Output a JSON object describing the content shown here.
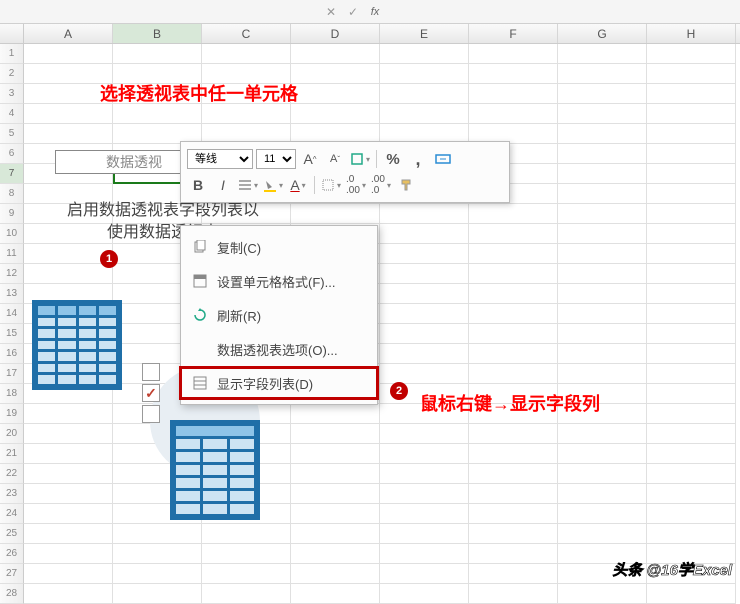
{
  "formula_bar": {
    "cancel": "✕",
    "confirm": "✓",
    "fx": "fx"
  },
  "columns": [
    "A",
    "B",
    "C",
    "D",
    "E",
    "F",
    "G",
    "H"
  ],
  "rows_start": 1,
  "rows_end": 28,
  "selected_row": 7,
  "selected_col_index": 1,
  "annotation1": "选择透视表中任一单元格",
  "annotation2": "鼠标右键→显示字段列",
  "pivot_title": "数据透视",
  "pivot_hint_line1": "启用数据透视表字段列表以",
  "pivot_hint_line2": "使用数据透视表",
  "badges": {
    "one": "1",
    "two": "2"
  },
  "mini_toolbar": {
    "font": "等线",
    "size": "11",
    "inc": "A",
    "dec": "A",
    "bold": "B",
    "italic": "I",
    "pct": "%",
    "comma": ",",
    "merge_icon": "⬛"
  },
  "context_menu": {
    "copy": "复制(C)",
    "format": "设置单元格格式(F)...",
    "refresh": "刷新(R)",
    "options": "数据透视表选项(O)...",
    "showfields": "显示字段列表(D)"
  },
  "watermark": "头条 @16学Excel"
}
